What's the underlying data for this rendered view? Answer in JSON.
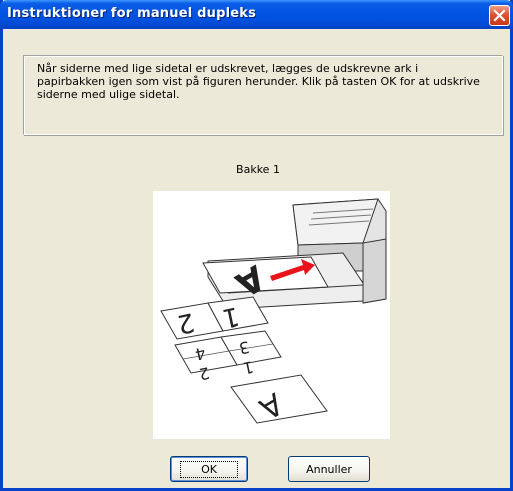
{
  "window": {
    "title": "Instruktioner for manuel dupleks"
  },
  "title_controls": {
    "close_icon": "close-icon"
  },
  "message": "Når siderne med lige sidetal er udskrevet, lægges de udskrevne ark i papirbakken igen som vist på figuren herunder. Klik på tasten OK for at udskrive siderne med ulige sidetal.",
  "tray_label": "Bakke 1",
  "illustration": {
    "icon": "printer-paper-tray-illustration",
    "sheet_letters": [
      "A",
      "2",
      "1",
      "4",
      "3",
      "2",
      "1",
      "A"
    ]
  },
  "buttons": {
    "ok": "OK",
    "cancel": "Annuller"
  },
  "colors": {
    "titlebar": "#0054E3",
    "dialog": "#ECE9D8",
    "arrow": "#E8141C",
    "close": "#E0512F"
  }
}
